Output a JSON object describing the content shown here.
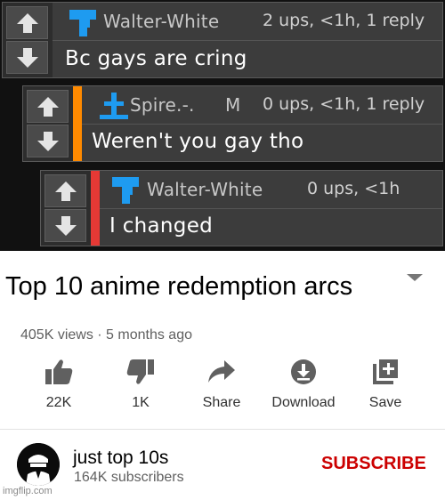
{
  "thread": {
    "comments": [
      {
        "author": "Walter-White",
        "badge": "",
        "meta": "2 ups, <1h, 1 reply",
        "text": "Bc gays are cring",
        "bar_color": "",
        "avatar_icon": "tetris-icon"
      },
      {
        "author": "Spire.-.",
        "badge": "M",
        "meta": "0 ups, <1h, 1 reply",
        "text": "Weren't you gay tho",
        "bar_color": "#ff8a00",
        "avatar_icon": "cross-icon"
      },
      {
        "author": "Walter-White",
        "badge": "",
        "meta": "0 ups, <1h",
        "text": "I changed",
        "bar_color": "#e53935",
        "avatar_icon": "tetris-icon"
      }
    ],
    "accent_color": "#1e9bf0"
  },
  "video": {
    "title": "Top 10 anime redemption arcs",
    "views_line": "405K views · 5 months ago",
    "actions": [
      {
        "label": "22K",
        "icon": "thumbs-up-icon"
      },
      {
        "label": "1K",
        "icon": "thumbs-down-icon"
      },
      {
        "label": "Share",
        "icon": "share-icon"
      },
      {
        "label": "Download",
        "icon": "download-icon"
      },
      {
        "label": "Save",
        "icon": "save-playlist-icon"
      }
    ]
  },
  "channel": {
    "name": "just top 10s",
    "subscribers": "164K subscribers",
    "subscribe_label": "SUBSCRIBE",
    "subscribe_color": "#cc0000"
  },
  "watermark": "imgflip.com"
}
